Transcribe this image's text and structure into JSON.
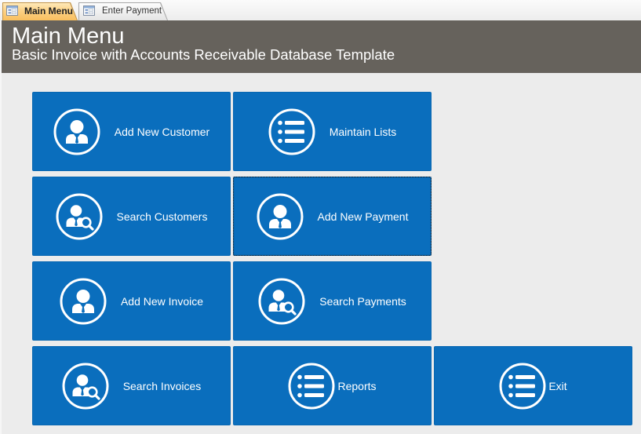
{
  "tabs": [
    {
      "label": "Main Menu",
      "icon": "form-icon",
      "active": true
    },
    {
      "label": "Enter Payment",
      "icon": "form-icon",
      "active": false
    }
  ],
  "header": {
    "title": "Main Menu",
    "subtitle": "Basic Invoice with Accounts Receivable Database Template"
  },
  "menu": {
    "buttons": [
      {
        "label": "Add New Customer",
        "icon": "person-icon"
      },
      {
        "label": "Maintain Lists",
        "icon": "list-icon"
      },
      {
        "label": "Search Customers",
        "icon": "person-search-icon"
      },
      {
        "label": "Add New Payment",
        "icon": "person-icon",
        "focused": true
      },
      {
        "label": "Add New Invoice",
        "icon": "person-icon"
      },
      {
        "label": "Search Payments",
        "icon": "person-search-icon"
      },
      {
        "label": "Search Invoices",
        "icon": "person-search-icon"
      },
      {
        "label": "Reports",
        "icon": "list-icon"
      },
      {
        "label": "Exit",
        "icon": "list-icon"
      }
    ]
  },
  "colors": {
    "header_background": "#66625c",
    "button_background": "#0a6ebd",
    "page_background": "#ececec",
    "active_tab": "#f9bf5e",
    "text_on_dark": "#ffffff"
  }
}
